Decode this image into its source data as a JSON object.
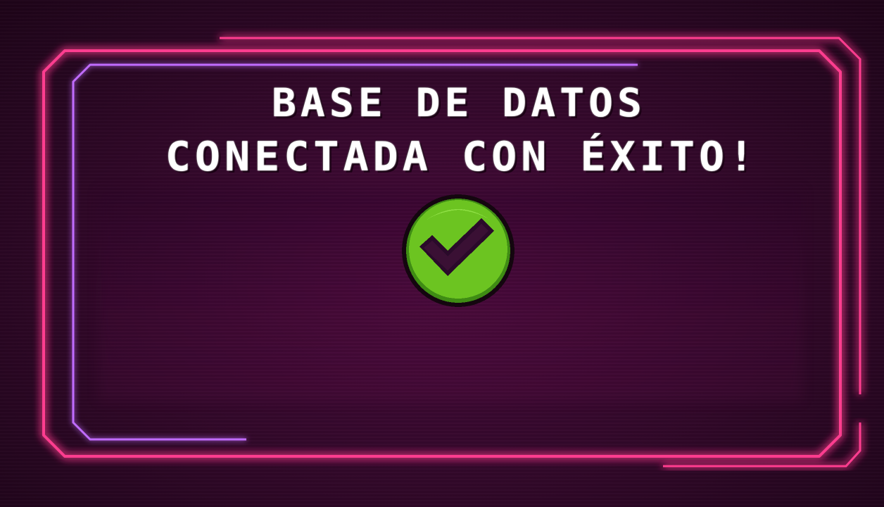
{
  "message": {
    "line1": "BASE DE DATOS",
    "line2": "CONECTADA CON ÉXITO!"
  },
  "status_icon": {
    "name": "checkmark-icon",
    "state": "success"
  },
  "colors": {
    "background": "#2a0a1e",
    "neon_pink": "#ff2d8a",
    "neon_violet": "#b04cff",
    "text": "#ffffff",
    "check_green": "#6cc421",
    "check_dark": "#2a0a2a"
  }
}
